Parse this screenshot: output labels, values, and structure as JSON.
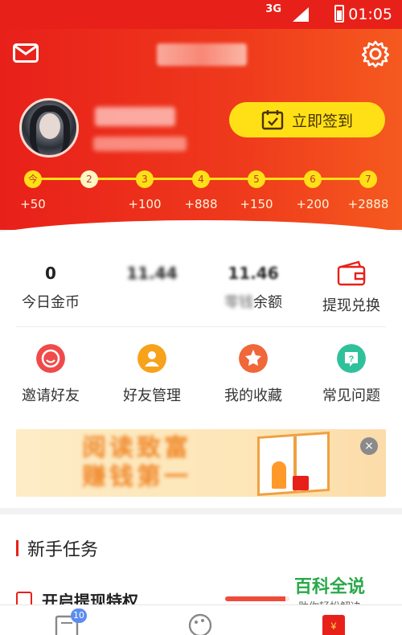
{
  "status_bar": {
    "network": "3G",
    "time": "01:05"
  },
  "header": {
    "title": "",
    "checkin_label": "立即签到",
    "days": [
      "今",
      "2",
      "3",
      "4",
      "5",
      "6",
      "7"
    ],
    "rewards": [
      "+50",
      "",
      "+100",
      "+888",
      "+150",
      "+200",
      "+2888"
    ]
  },
  "stats": [
    {
      "value": "0",
      "label": "今日金币",
      "blurred": false
    },
    {
      "value": "",
      "label": "",
      "blurred": true
    },
    {
      "value": "11.46",
      "label": "余额",
      "blurred": true
    },
    {
      "value": "",
      "label": "提现兑换",
      "icon": "wallet-icon"
    }
  ],
  "features": [
    {
      "label": "邀请好友",
      "icon": "smile-icon",
      "color": "#f04a4a"
    },
    {
      "label": "好友管理",
      "icon": "friend-icon",
      "color": "#f7a21b"
    },
    {
      "label": "我的收藏",
      "icon": "star-icon",
      "color": "#f0673a"
    },
    {
      "label": "常见问题",
      "icon": "question-icon",
      "color": "#2fc29a"
    }
  ],
  "banner": {
    "close_glyph": "×"
  },
  "tasks": {
    "section_title": "新手任务",
    "first_task": "开启提现特权"
  },
  "watermark": {
    "line1": "百科全说",
    "line2": "助你轻松解决"
  },
  "bottom_nav": {
    "badge_count": "10"
  },
  "colors": {
    "primary": "#e8201a",
    "accent_yellow": "#ffe017"
  }
}
